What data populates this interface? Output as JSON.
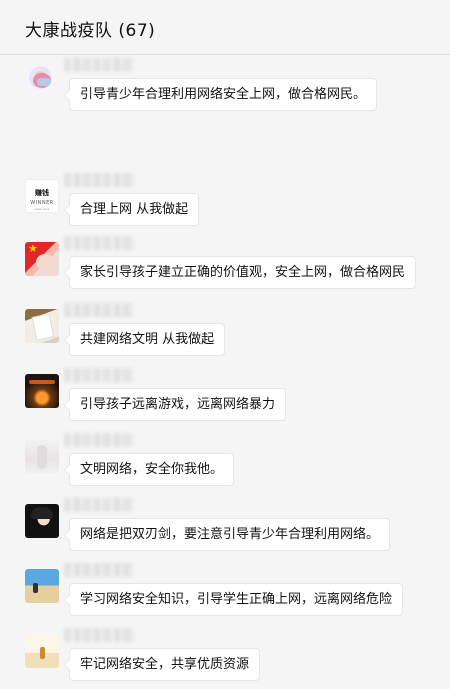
{
  "header": {
    "title": "大康战疫队 (67)"
  },
  "messages": [
    {
      "avatar": "pink-abstract-avatar",
      "text": "引导青少年合理利用网络安全上网，做合格网民。"
    },
    {
      "avatar": "winner-text-avatar",
      "avatar_text": [
        "赚钱",
        "WINNER",
        "ɢᴏᴏᴅ ʟᴜᴄᴋ"
      ],
      "text": "合理上网 从我做起"
    },
    {
      "avatar": "flag-avatar",
      "text": "家长引导孩子建立正确的价值观，安全上网，做合格网民"
    },
    {
      "avatar": "card-photo-avatar",
      "text": "共建网络文明 从我做起"
    },
    {
      "avatar": "fire-photo-avatar",
      "text": "引导孩子远离游戏，远离网络暴力"
    },
    {
      "avatar": "light-photo-avatar",
      "text": "文明网络，安全你我他。"
    },
    {
      "avatar": "portrait-avatar",
      "text": "网络是把双刃剑，要注意引导青少年合理利用网络。"
    },
    {
      "avatar": "beach-photo-avatar",
      "text": "学习网络安全知识，引导学生正确上网，远离网络危险"
    },
    {
      "avatar": "desert-photo-avatar",
      "text": "牢记网络安全，共享优质资源"
    }
  ]
}
